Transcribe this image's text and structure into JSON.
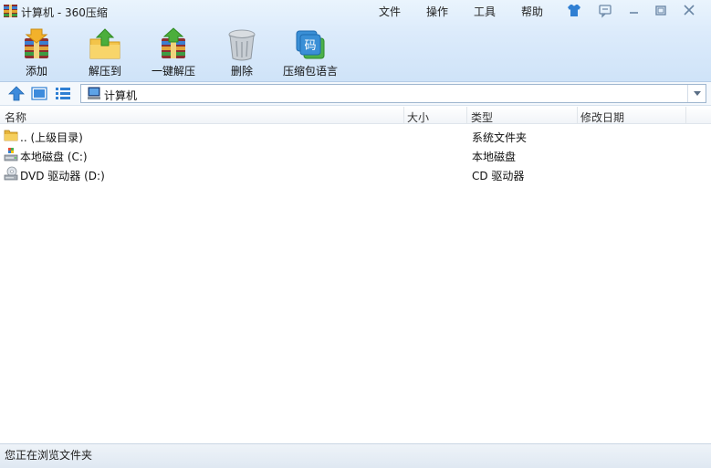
{
  "window": {
    "title": "计算机 - 360压缩"
  },
  "menu": [
    {
      "label": "文件"
    },
    {
      "label": "操作"
    },
    {
      "label": "工具"
    },
    {
      "label": "帮助"
    }
  ],
  "toolbar": [
    {
      "label": "添加",
      "icon": "add-archive-icon"
    },
    {
      "label": "解压到",
      "icon": "extract-to-icon"
    },
    {
      "label": "一键解压",
      "icon": "one-click-extract-icon"
    },
    {
      "label": "删除",
      "icon": "trash-icon"
    },
    {
      "label": "压缩包语言",
      "icon": "archive-language-icon",
      "glyph": "码"
    }
  ],
  "address": {
    "path": "计算机"
  },
  "columns": [
    {
      "label": "名称"
    },
    {
      "label": "大小"
    },
    {
      "label": "类型"
    },
    {
      "label": "修改日期"
    }
  ],
  "files": [
    {
      "name": ".. (上级目录)",
      "size": "",
      "type": "系统文件夹",
      "modified": "",
      "icon": "folder-icon"
    },
    {
      "name": "本地磁盘 (C:)",
      "size": "",
      "type": "本地磁盘",
      "modified": "",
      "icon": "local-disk-icon"
    },
    {
      "name": "DVD 驱动器 (D:)",
      "size": "",
      "type": "CD 驱动器",
      "modified": "",
      "icon": "dvd-drive-icon"
    }
  ],
  "status": {
    "text": "您正在浏览文件夹"
  },
  "colors": {
    "accent": "#2f7fd3",
    "toolbar_bg": "#dcebfb"
  }
}
